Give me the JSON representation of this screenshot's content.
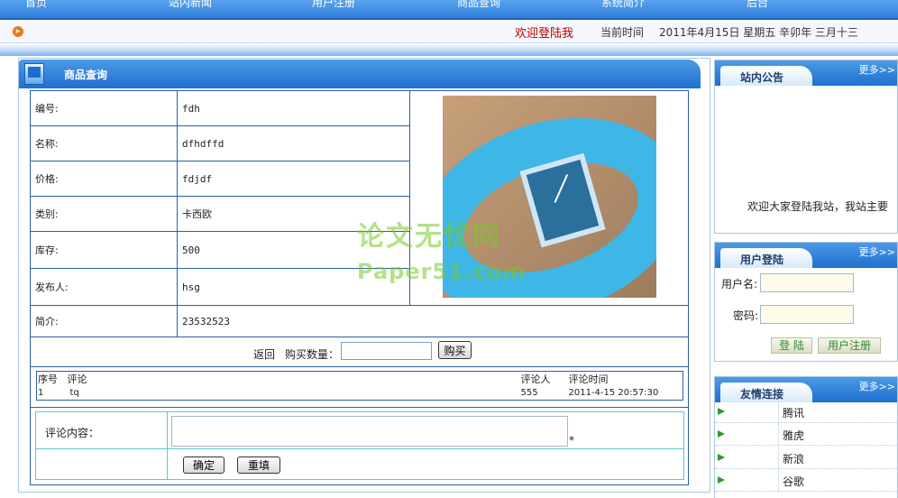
{
  "nav": {
    "items": [
      "首页",
      "站内新闻",
      "用户注册",
      "商品查询",
      "系统简介",
      "后台"
    ]
  },
  "ticker": {
    "welcome": "欢迎登陆我",
    "time_label": "当前时间",
    "time_value": "2011年4月15日 星期五 辛卯年 三月十三"
  },
  "panel": {
    "title": "商品查询"
  },
  "product": {
    "fields": [
      {
        "label": "编号:",
        "value": "fdh"
      },
      {
        "label": "名称:",
        "value": "dfhdffd"
      },
      {
        "label": "价格:",
        "value": "fdjdf"
      },
      {
        "label": "类别:",
        "value": "卡西欧"
      },
      {
        "label": "库存:",
        "value": "500"
      },
      {
        "label": "发布人:",
        "value": "hsg"
      },
      {
        "label": "简介:",
        "value": "23532523"
      }
    ]
  },
  "buy": {
    "back_label": "返回",
    "qty_label": "购买数量：",
    "qty_value": "",
    "buy_button": "购买"
  },
  "comments": {
    "headers": [
      "序号",
      "评论",
      "评论人",
      "评论时间"
    ],
    "rows": [
      {
        "no": "1",
        "text": "tq",
        "author": "555",
        "time": "2011-4-15 20:57:30"
      }
    ]
  },
  "comment_form": {
    "label": "评论内容：",
    "required_mark": "*",
    "ok_button": "确定",
    "reset_button": "重填"
  },
  "notice": {
    "title": "站内公告",
    "more": "更多>>",
    "text": "欢迎大家登陆我站，我站主要"
  },
  "login": {
    "title": "用户登陆",
    "more": "更多>>",
    "user_label": "用户名:",
    "pwd_label": "密码:",
    "login_button": "登 陆",
    "register_button": "用户注册"
  },
  "links": {
    "title": "友情连接",
    "more": "更多>>",
    "items": [
      "腾讯",
      "雅虎",
      "新浪",
      "谷歌"
    ]
  },
  "watermark": {
    "line1": "论文无忧网",
    "line2": "Paper51.com"
  },
  "colors": {
    "header_blue": "#2f7fd9",
    "welcome_red": "#c00000",
    "table_border": "#2a5fa8"
  }
}
